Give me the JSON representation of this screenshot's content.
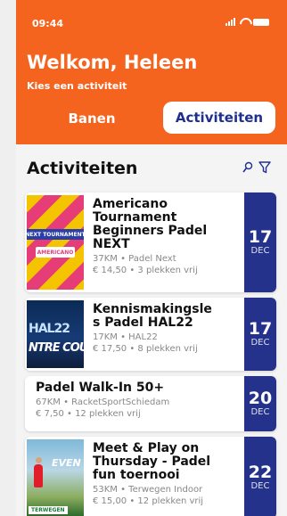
{
  "status": {
    "time": "09:44"
  },
  "header": {
    "title": "Welkom, Heleen",
    "subtitle": "Kies een activiteit"
  },
  "tabs": [
    {
      "label": "Banen"
    },
    {
      "label": "Activiteiten"
    }
  ],
  "section": {
    "title": "Activiteiten"
  },
  "activities": [
    {
      "title_lines": [
        "Americano",
        "Tournament",
        "Beginners Padel",
        "NEXT"
      ],
      "meta": [
        "37KM • Padel Next",
        "€ 14,50 • 3 plekken vrij"
      ],
      "day": "17",
      "month": "DEC",
      "thumb_text": [
        "NEXT TOURNAMENT",
        "AMERICANO"
      ]
    },
    {
      "title_lines": [
        "Kennismakingsle",
        "s Padel HAL22"
      ],
      "meta": [
        "17KM • HAL22",
        "€ 17,50 • 8 plekken vrij"
      ],
      "day": "17",
      "month": "DEC",
      "thumb_text": [
        "HAL22",
        "NTRE COU"
      ]
    },
    {
      "title_lines": [
        "Padel Walk-In 50+"
      ],
      "meta": [
        "67KM • RacketSportSchiedam",
        "€ 7,50 • 12 plekken vrij"
      ],
      "day": "20",
      "month": "DEC"
    },
    {
      "title_lines": [
        "Meet & Play on",
        "Thursday - Padel",
        "fun toernooi"
      ],
      "meta": [
        "53KM • Terwegen Indoor",
        "€ 15,00 • 12 plekken vrij"
      ],
      "day": "22",
      "month": "DEC",
      "thumb_text": [
        "EVEN",
        "TERWEGEN"
      ]
    }
  ],
  "colors": {
    "accent": "#f5641e",
    "brand": "#24328c"
  }
}
